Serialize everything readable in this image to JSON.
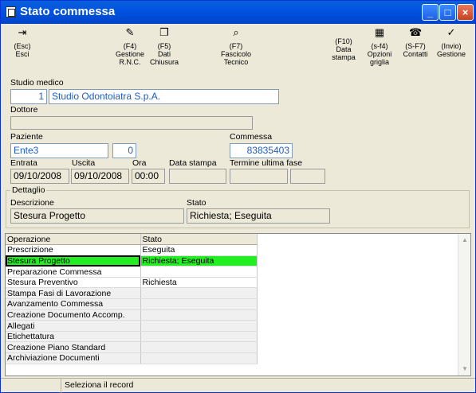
{
  "window": {
    "title": "Stato commessa"
  },
  "toolbar": {
    "esc": {
      "key": "(Esc)",
      "label": "Esci"
    },
    "f4": {
      "key": "(F4)",
      "label": "Gestione R.N.C."
    },
    "f5": {
      "key": "(F5)",
      "label": "Dati Chiusura"
    },
    "f7": {
      "key": "(F7)",
      "label": "Fascicolo Tecnico"
    },
    "f10": {
      "key": "(F10)",
      "label": "Data stampa"
    },
    "sf4": {
      "key": "(s-f4)",
      "label": "Opzioni griglia"
    },
    "sf7": {
      "key": "(S-F7)",
      "label": "Contatti"
    },
    "invio": {
      "key": "(Invio)",
      "label": "Gestione"
    }
  },
  "form": {
    "studio_label": "Studio medico",
    "studio_code": "1",
    "studio_name": "Studio Odontoiatra S.p.A.",
    "dottore_label": "Dottore",
    "dottore_value": "",
    "paziente_label": "Paziente",
    "paziente_value": "Ente3",
    "paziente_code": "0",
    "commessa_label": "Commessa",
    "commessa_value": "83835403",
    "entrata_label": "Entrata",
    "entrata_value": "09/10/2008",
    "uscita_label": "Uscita",
    "uscita_value": "09/10/2008",
    "ora_label": "Ora",
    "ora_value": "00:00",
    "data_stampa_label": "Data stampa",
    "data_stampa_value": "",
    "termine_label": "Termine ultima fase",
    "termine_value1": "",
    "termine_value2": ""
  },
  "dettaglio": {
    "title": "Dettaglio",
    "descrizione_label": "Descrizione",
    "descrizione_value": "Stesura Progetto",
    "stato_label": "Stato",
    "stato_value": "Richiesta; Eseguita"
  },
  "grid": {
    "headers": [
      "Operazione",
      "Stato"
    ],
    "rows": [
      {
        "op": "Prescrizione",
        "stato": "Eseguita"
      },
      {
        "op": "Stesura Progetto",
        "stato": "Richiesta; Eseguita"
      },
      {
        "op": "Preparazione Commessa",
        "stato": ""
      },
      {
        "op": "Stesura Preventivo",
        "stato": "Richiesta"
      },
      {
        "op": "Stampa Fasi di Lavorazione",
        "stato": ""
      },
      {
        "op": "Avanzamento Commessa",
        "stato": ""
      },
      {
        "op": "Creazione Documento Accomp.",
        "stato": ""
      },
      {
        "op": "Allegati",
        "stato": ""
      },
      {
        "op": "Etichettatura",
        "stato": ""
      },
      {
        "op": "Creazione Piano Standard",
        "stato": ""
      },
      {
        "op": "Archiviazione Documenti",
        "stato": ""
      }
    ]
  },
  "status": {
    "message": "Seleziona il record"
  }
}
